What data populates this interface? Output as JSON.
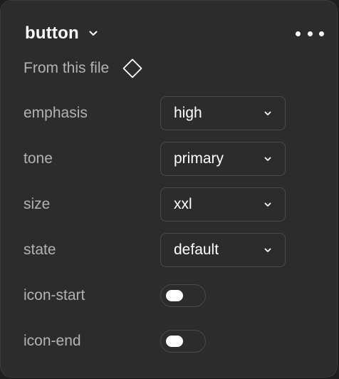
{
  "header": {
    "title": "button",
    "chevron_icon": "chevron-down-icon",
    "more_icon": "more-horizontal-icon"
  },
  "source": {
    "label": "From this file",
    "icon": "component-diamond-icon"
  },
  "properties": [
    {
      "label": "emphasis",
      "type": "select",
      "value": "high"
    },
    {
      "label": "tone",
      "type": "select",
      "value": "primary"
    },
    {
      "label": "size",
      "type": "select",
      "value": "xxl"
    },
    {
      "label": "state",
      "type": "select",
      "value": "default"
    },
    {
      "label": "icon-start",
      "type": "toggle",
      "value": false
    },
    {
      "label": "icon-end",
      "type": "toggle",
      "value": false
    }
  ],
  "colors": {
    "panel_background": "#2c2c2c",
    "border": "#4a4a4a",
    "text_primary": "#ffffff",
    "text_secondary": "#b3b3b3"
  }
}
